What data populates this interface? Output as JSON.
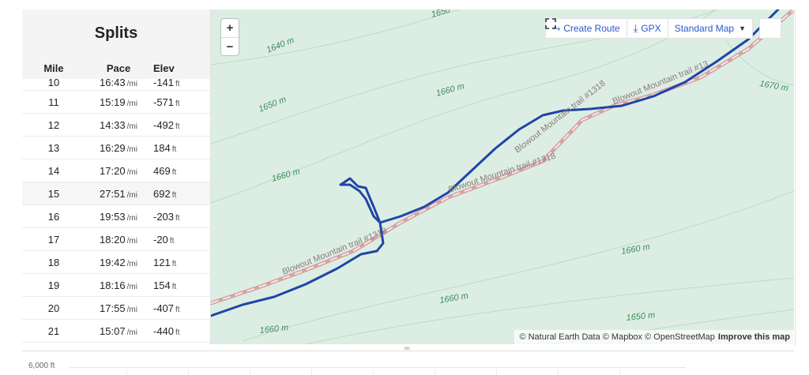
{
  "splits": {
    "title": "Splits",
    "columns": [
      "Mile",
      "Pace",
      "Elev"
    ],
    "pace_unit": "/mi",
    "elev_unit": "ft",
    "rows": [
      {
        "mile": "10",
        "pace": "16:43",
        "elev": "-141"
      },
      {
        "mile": "11",
        "pace": "15:19",
        "elev": "-571"
      },
      {
        "mile": "12",
        "pace": "14:33",
        "elev": "-492"
      },
      {
        "mile": "13",
        "pace": "16:29",
        "elev": "184"
      },
      {
        "mile": "14",
        "pace": "17:20",
        "elev": "469"
      },
      {
        "mile": "15",
        "pace": "27:51",
        "elev": "692"
      },
      {
        "mile": "16",
        "pace": "19:53",
        "elev": "-203"
      },
      {
        "mile": "17",
        "pace": "18:20",
        "elev": "-20"
      },
      {
        "mile": "18",
        "pace": "19:42",
        "elev": "121"
      },
      {
        "mile": "19",
        "pace": "18:16",
        "elev": "154"
      },
      {
        "mile": "20",
        "pace": "17:55",
        "elev": "-407"
      },
      {
        "mile": "21",
        "pace": "15:07",
        "elev": "-440"
      }
    ]
  },
  "map": {
    "zoom_in": "+",
    "zoom_out": "−",
    "toolbar": {
      "create_route": "Create Route",
      "gpx": "GPX",
      "map_style": "Standard Map",
      "fullscreen_icon": "expand-icon"
    },
    "contour_labels": [
      "1640 m",
      "1650",
      "1660 m",
      "1650 m",
      "1670 m",
      "1660 m",
      "1660 m",
      "1660 m",
      "1660 m",
      "1650 m"
    ],
    "trail_labels": [
      "Blowout Mountain trail #1318",
      "Blowout Mountain trail #13",
      "Blowout Mountain trail #1318",
      "Blowout Mountain trail #1318"
    ],
    "attribution": "© Natural Earth Data © Mapbox © OpenStreetMap",
    "attribution_link": "Improve this map",
    "colors": {
      "background": "#dceee3",
      "route": "#1f45a8",
      "trail": "#d4a3a3",
      "contour": "#b8d3c3",
      "label": "#3f8a5f"
    }
  },
  "elevation_chart": {
    "y_tick": "6,000 ft"
  }
}
